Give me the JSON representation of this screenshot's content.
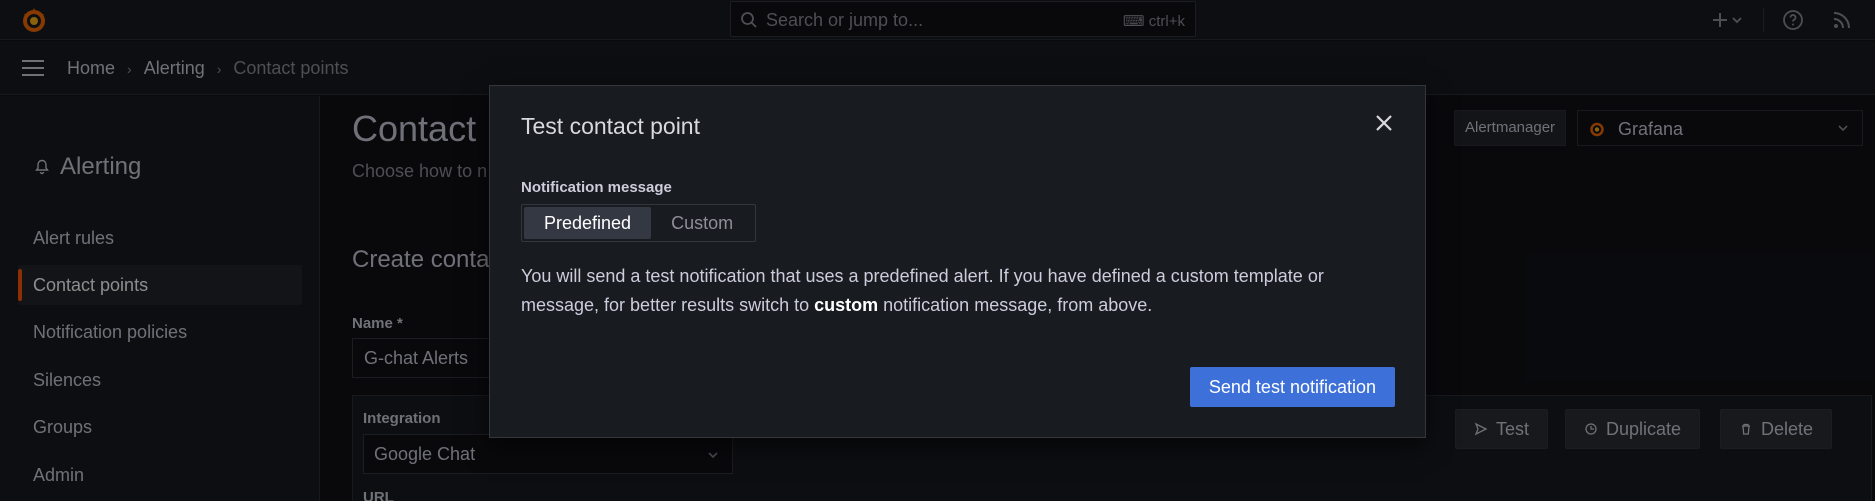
{
  "topbar": {
    "search_placeholder": "Search or jump to...",
    "search_shortcut": "ctrl+k",
    "icons": [
      "grafana-logo-icon",
      "plus-icon",
      "chevron-down-icon",
      "help-icon",
      "news-rss-icon"
    ]
  },
  "breadcrumb": {
    "items": [
      "Home",
      "Alerting",
      "Contact points"
    ],
    "separator": "›"
  },
  "sidebar": {
    "title": "Alerting",
    "items": [
      {
        "label": "Alert rules",
        "active": false
      },
      {
        "label": "Contact points",
        "active": true
      },
      {
        "label": "Notification policies",
        "active": false
      },
      {
        "label": "Silences",
        "active": false
      },
      {
        "label": "Groups",
        "active": false
      },
      {
        "label": "Admin",
        "active": false
      }
    ]
  },
  "page": {
    "title": "Contact",
    "subtitle": "Choose how to n",
    "alertmanager_label": "Alertmanager",
    "alertmanager_value": "Grafana",
    "section_title": "Create conta",
    "name_label": "Name *",
    "name_value": "G-chat Alerts",
    "integration_label": "Integration",
    "integration_value": "Google Chat",
    "url_label": "URL",
    "actions": [
      "Test",
      "Duplicate",
      "Delete"
    ]
  },
  "modal": {
    "title": "Test contact point",
    "message_label": "Notification message",
    "options": [
      "Predefined",
      "Custom"
    ],
    "selected_option": "Predefined",
    "description_before": "You will send a test notification that uses a predefined alert. If you have defined a custom template or message, for better results switch to ",
    "description_bold": "custom",
    "description_after": " notification message, from above.",
    "send_button": "Send test notification"
  },
  "colors": {
    "accent_orange": "#ff5705",
    "primary_blue": "#3d71d9",
    "background": "#111217",
    "panel": "#181b1f"
  }
}
